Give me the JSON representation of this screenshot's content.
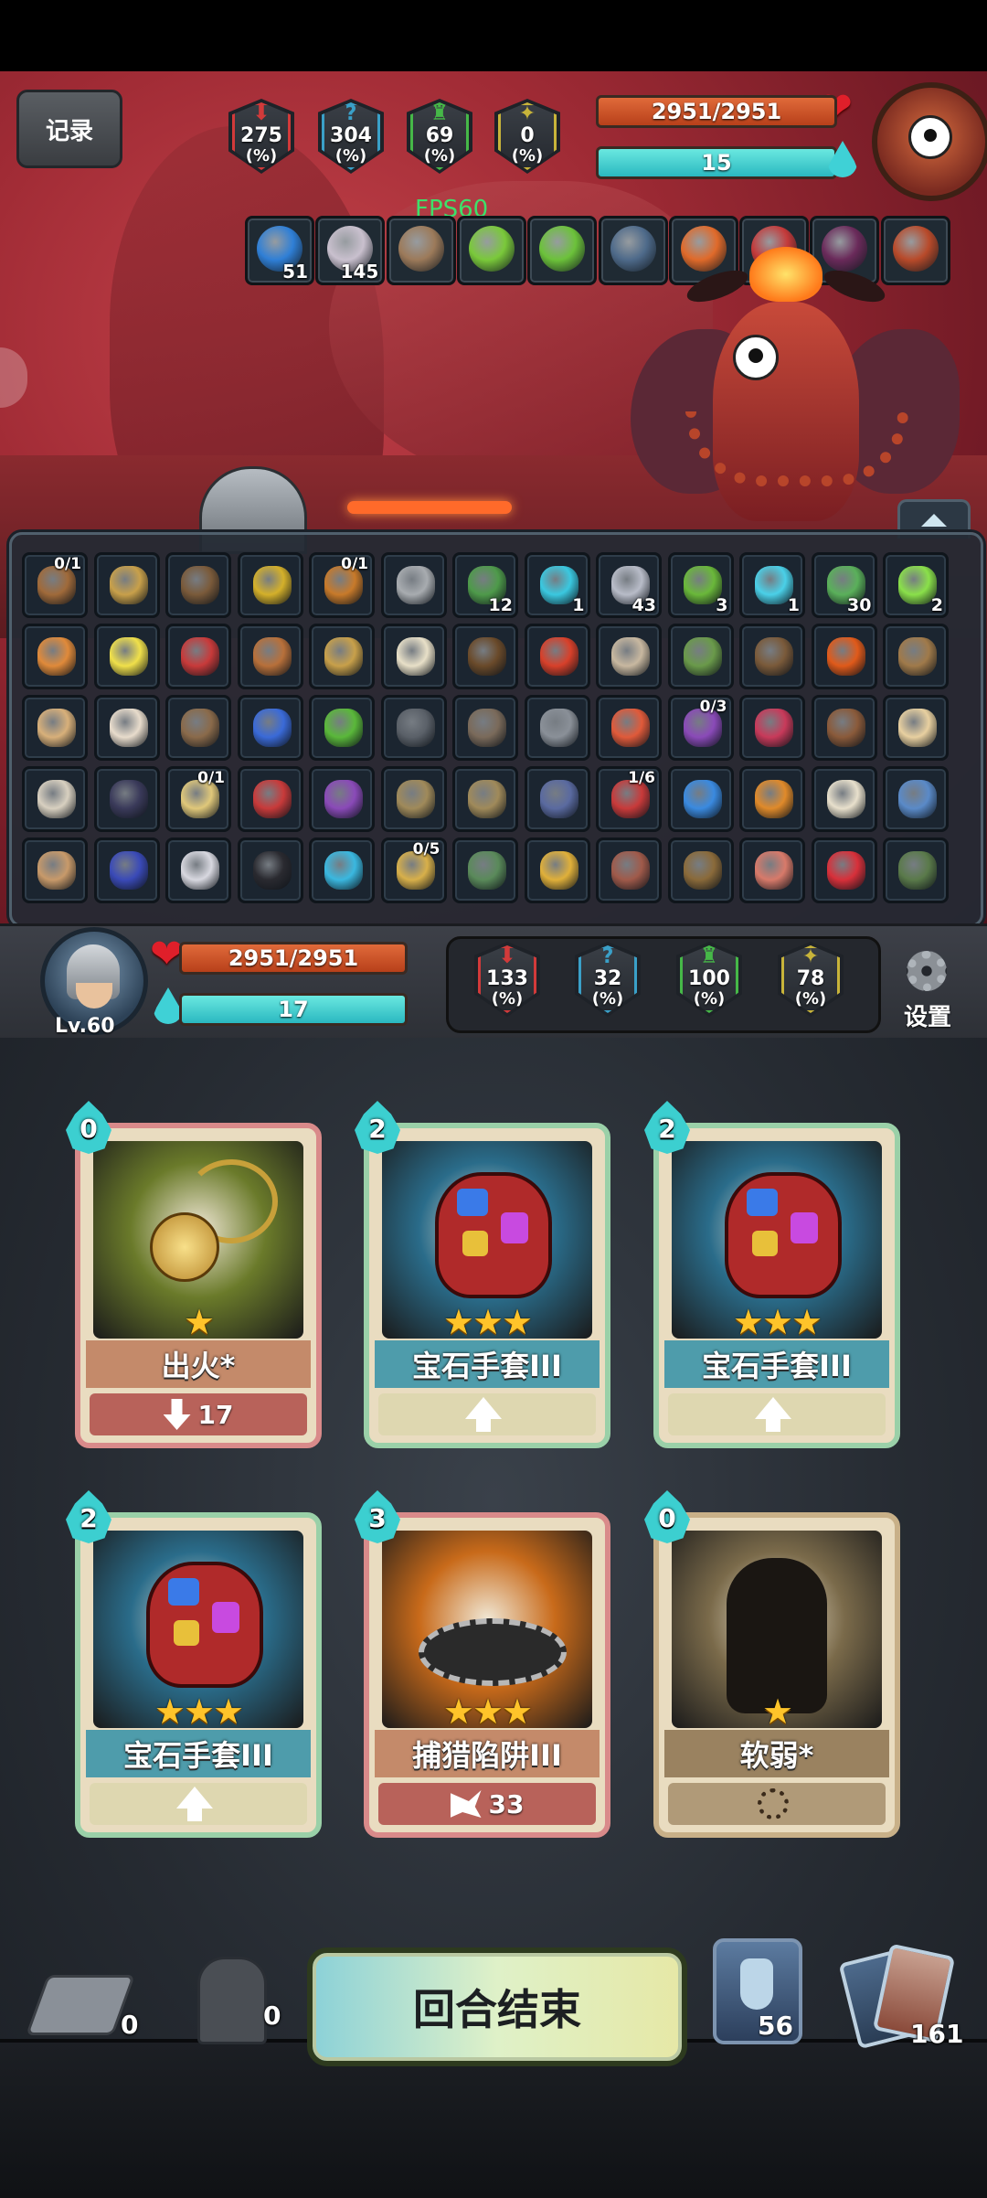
{
  "top": {
    "log_button": "记录",
    "fps": "FPS60",
    "stats": [
      {
        "value": "275",
        "unit": "(%)",
        "icon": "attack-sword-icon",
        "color": "#d23a3a"
      },
      {
        "value": "304",
        "unit": "(%)",
        "icon": "question-mark-icon",
        "color": "#3aa0c8"
      },
      {
        "value": "69",
        "unit": "(%)",
        "icon": "defense-tower-icon",
        "color": "#46b848"
      },
      {
        "value": "0",
        "unit": "(%)",
        "icon": "spike-icon",
        "color": "#c8b43a"
      }
    ],
    "enemy_hp": "2951/2951",
    "enemy_hp_fraction": 1.0,
    "enemy_energy": "15",
    "enemy_energy_fraction": 1.0,
    "buffs": [
      {
        "icon": "blue-shield-icon",
        "count": "51",
        "color": "#2f7fd6"
      },
      {
        "icon": "swirl-orb-icon",
        "count": "145",
        "color": "#c9c0ce"
      },
      {
        "icon": "spellbook-icon",
        "count": "",
        "color": "#9c7a5a"
      },
      {
        "icon": "green-slime-icon",
        "count": "",
        "color": "#7ac93a"
      },
      {
        "icon": "green-gem-icon",
        "count": "",
        "color": "#6cc23a"
      },
      {
        "icon": "dark-tower-icon",
        "count": "",
        "color": "#4e6a8a"
      },
      {
        "icon": "fire-claw-icon",
        "count": "",
        "color": "#e06a2a"
      },
      {
        "icon": "red-crab-icon",
        "count": "",
        "color": "#c43a3a"
      },
      {
        "icon": "purple-claw-icon",
        "count": "",
        "color": "#6a2a5a"
      },
      {
        "icon": "bead-necklace-icon",
        "count": "",
        "color": "#b84a2a"
      }
    ]
  },
  "inventory": {
    "items": [
      {
        "icon": "sack-icon",
        "color": "#a06a3a",
        "frac": "0/1",
        "count": ""
      },
      {
        "icon": "hourglass-icon",
        "color": "#c8a04a",
        "frac": "",
        "count": ""
      },
      {
        "icon": "scroll-icon",
        "color": "#7a5a3a",
        "frac": "",
        "count": ""
      },
      {
        "icon": "golden-swirl-icon",
        "color": "#d4b02a",
        "frac": "",
        "count": ""
      },
      {
        "icon": "horn-icon",
        "color": "#c87a2a",
        "frac": "0/1",
        "count": ""
      },
      {
        "icon": "helmet-icon",
        "color": "#a8acb0",
        "frac": "",
        "count": ""
      },
      {
        "icon": "green-serpent-icon",
        "color": "#4e9a4a",
        "frac": "",
        "count": "12"
      },
      {
        "icon": "cyan-crescent-icon",
        "color": "#3ac8e0",
        "frac": "",
        "count": "1"
      },
      {
        "icon": "silver-helm-icon",
        "color": "#b8bcc8",
        "frac": "",
        "count": "43"
      },
      {
        "icon": "green-blob-icon",
        "color": "#6ab83a",
        "frac": "",
        "count": "3"
      },
      {
        "icon": "cyan-face-icon",
        "color": "#4ad0e8",
        "frac": "",
        "count": "1"
      },
      {
        "icon": "green-skull-icon",
        "color": "#5ab05a",
        "frac": "",
        "count": "30"
      },
      {
        "icon": "green-slash-icon",
        "color": "#8ae04a",
        "frac": "",
        "count": "2"
      },
      {
        "icon": "wrench-icon",
        "color": "#e08a3a",
        "frac": "",
        "count": ""
      },
      {
        "icon": "sun-burst-icon",
        "color": "#f0e04a",
        "frac": "",
        "count": ""
      },
      {
        "icon": "red-glove-icon",
        "color": "#c83a3a",
        "frac": "",
        "count": ""
      },
      {
        "icon": "cookie-icon",
        "color": "#b8703a",
        "frac": "",
        "count": ""
      },
      {
        "icon": "hourglass-icon",
        "color": "#c8a04a",
        "frac": "",
        "count": ""
      },
      {
        "icon": "dice-icon",
        "color": "#e8e0c8",
        "frac": "",
        "count": ""
      },
      {
        "icon": "coin-pouch-icon",
        "color": "#6a4a2a",
        "frac": "",
        "count": ""
      },
      {
        "icon": "red-feather-icon",
        "color": "#d8402a",
        "frac": "",
        "count": ""
      },
      {
        "icon": "bell-icon",
        "color": "#c8b8a0",
        "frac": "",
        "count": ""
      },
      {
        "icon": "green-flask-icon",
        "color": "#6a9a4a",
        "frac": "",
        "count": ""
      },
      {
        "icon": "voodoo-doll-icon",
        "color": "#7a5a3a",
        "frac": "",
        "count": ""
      },
      {
        "icon": "fire-apple-icon",
        "color": "#e05a1a",
        "frac": "",
        "count": ""
      },
      {
        "icon": "broom-icon",
        "color": "#a07a4a",
        "frac": "",
        "count": ""
      },
      {
        "icon": "parchment-icon",
        "color": "#d8b07a",
        "frac": "",
        "count": ""
      },
      {
        "icon": "bone-icon",
        "color": "#e8dccc",
        "frac": "",
        "count": ""
      },
      {
        "icon": "wooden-stakes-icon",
        "color": "#8a6a4a",
        "frac": "",
        "count": ""
      },
      {
        "icon": "blue-dagger-icon",
        "color": "#3a6ad8",
        "frac": "",
        "count": ""
      },
      {
        "icon": "green-coin-icon",
        "color": "#5ab83a",
        "frac": "",
        "count": ""
      },
      {
        "icon": "dark-cloak-icon",
        "color": "#5a6068",
        "frac": "",
        "count": ""
      },
      {
        "icon": "crossbow-icon",
        "color": "#7a6a5a",
        "frac": "",
        "count": ""
      },
      {
        "icon": "trident-icon",
        "color": "#8a9098",
        "frac": "",
        "count": ""
      },
      {
        "icon": "fire-spear-icon",
        "color": "#e05a3a",
        "frac": "",
        "count": ""
      },
      {
        "icon": "purple-worm-icon",
        "color": "#8a4ab8",
        "frac": "0/3",
        "count": ""
      },
      {
        "icon": "red-wand-icon",
        "color": "#c83a5a",
        "frac": "",
        "count": ""
      },
      {
        "icon": "leather-glove-icon",
        "color": "#8a5a3a",
        "frac": "",
        "count": ""
      },
      {
        "icon": "potion-bag-icon",
        "color": "#e8d0a0",
        "frac": "",
        "count": ""
      },
      {
        "icon": "claw-icon",
        "color": "#d8d0c0",
        "frac": "",
        "count": ""
      },
      {
        "icon": "spiked-ball-icon",
        "color": "#3a3a5a",
        "frac": "",
        "count": ""
      },
      {
        "icon": "pacifier-icon",
        "color": "#e0c87a",
        "frac": "0/1",
        "count": ""
      },
      {
        "icon": "red-orb-icon",
        "color": "#c83a3a",
        "frac": "",
        "count": ""
      },
      {
        "icon": "mask-icon",
        "color": "#8a4ab8",
        "frac": "",
        "count": ""
      },
      {
        "icon": "scales-icon",
        "color": "#a08a5a",
        "frac": "",
        "count": ""
      },
      {
        "icon": "scales-icon",
        "color": "#a08a5a",
        "frac": "",
        "count": ""
      },
      {
        "icon": "gauntlet-icon",
        "color": "#5a6aa0",
        "frac": "",
        "count": ""
      },
      {
        "icon": "red-tome-icon",
        "color": "#c83a3a",
        "frac": "1/6",
        "count": ""
      },
      {
        "icon": "blue-swirl-icon",
        "color": "#3a8ae0",
        "frac": "",
        "count": ""
      },
      {
        "icon": "fire-staff-icon",
        "color": "#e08a2a",
        "frac": "",
        "count": ""
      },
      {
        "icon": "bandage-icon",
        "color": "#e8e0cc",
        "frac": "",
        "count": ""
      },
      {
        "icon": "blue-key-icon",
        "color": "#5a8ac8",
        "frac": "",
        "count": ""
      },
      {
        "icon": "hooded-head-icon",
        "color": "#c89a6a",
        "frac": "",
        "count": ""
      },
      {
        "icon": "blue-crest-icon",
        "color": "#3a4ab8",
        "frac": "",
        "count": ""
      },
      {
        "icon": "ghost-boot-icon",
        "color": "#d8d8e0",
        "frac": "",
        "count": ""
      },
      {
        "icon": "black-mask-icon",
        "color": "#2a2a30",
        "frac": "",
        "count": ""
      },
      {
        "icon": "cyan-rune-icon",
        "color": "#3ab8e0",
        "frac": "",
        "count": ""
      },
      {
        "icon": "golden-ring-icon",
        "color": "#d8b04a",
        "frac": "0/5",
        "count": ""
      },
      {
        "icon": "green-helm-icon",
        "color": "#5a8a5a",
        "frac": "",
        "count": ""
      },
      {
        "icon": "gold-amulet-icon",
        "color": "#e0b03a",
        "frac": "",
        "count": ""
      },
      {
        "icon": "thorn-branch-icon",
        "color": "#a05a4a",
        "frac": "",
        "count": ""
      },
      {
        "icon": "mushroom-icon",
        "color": "#8a6a3a",
        "frac": "",
        "count": ""
      },
      {
        "icon": "meat-icon",
        "color": "#d87a6a",
        "frac": "",
        "count": ""
      },
      {
        "icon": "rose-icon",
        "color": "#d8303a",
        "frac": "",
        "count": ""
      },
      {
        "icon": "dragon-egg-icon",
        "color": "#5a7a4a",
        "frac": "",
        "count": ""
      }
    ]
  },
  "player": {
    "level": "Lv.60",
    "hp": "2951/2951",
    "hp_fraction": 1.0,
    "energy": "17",
    "energy_fraction": 1.0,
    "stats": [
      {
        "value": "133",
        "unit": "(%)",
        "icon": "attack-sword-icon",
        "color": "#d23a3a"
      },
      {
        "value": "32",
        "unit": "(%)",
        "icon": "question-mark-icon",
        "color": "#3aa0c8"
      },
      {
        "value": "100",
        "unit": "(%)",
        "icon": "defense-tower-icon",
        "color": "#46b848"
      },
      {
        "value": "78",
        "unit": "(%)",
        "icon": "spike-icon",
        "color": "#c8b43a"
      }
    ],
    "settings_label": "设置"
  },
  "cards": [
    {
      "cost": "0",
      "name": "出火*",
      "stars": 1,
      "foot_value": "17",
      "foot_icon": "arrow-down-icon",
      "art": "golden-bell-art",
      "border": "#d98a8a",
      "title_bg": "#c48a6a",
      "foot_bg": "#b8625a",
      "art_bg": "#6a7a2a"
    },
    {
      "cost": "2",
      "name": "宝石手套III",
      "stars": 3,
      "foot_value": "",
      "foot_icon": "arrow-up-icon",
      "art": "gem-gauntlet-art",
      "border": "#9ad0a8",
      "title_bg": "#4e9cab",
      "foot_bg": "#ded7b0",
      "art_bg": "#2a6c8a"
    },
    {
      "cost": "2",
      "name": "宝石手套III",
      "stars": 3,
      "foot_value": "",
      "foot_icon": "arrow-up-icon",
      "art": "gem-gauntlet-art",
      "border": "#9ad0a8",
      "title_bg": "#4e9cab",
      "foot_bg": "#ded7b0",
      "art_bg": "#2a6c8a"
    },
    {
      "cost": "2",
      "name": "宝石手套III",
      "stars": 3,
      "foot_value": "",
      "foot_icon": "arrow-up-icon",
      "art": "gem-gauntlet-art",
      "border": "#9ad0a8",
      "title_bg": "#4e9cab",
      "foot_bg": "#ded7b0",
      "art_bg": "#2a6c8a"
    },
    {
      "cost": "3",
      "name": "捕猎陷阱III",
      "stars": 3,
      "foot_value": "33",
      "foot_icon": "claw-icon",
      "art": "bear-trap-art",
      "border": "#d98a8a",
      "title_bg": "#c48a6a",
      "foot_bg": "#b8625a",
      "art_bg": "#c86a1a"
    },
    {
      "cost": "0",
      "name": "软弱*",
      "stars": 1,
      "foot_value": "",
      "foot_icon": "spiral-icon",
      "art": "weak-silhouette-art",
      "border": "#c8b088",
      "title_bg": "#9a8260",
      "foot_bg": "#b09a78",
      "art_bg": "#7a6a4a"
    }
  ],
  "bottom": {
    "end_turn": "回合结束",
    "discard_count": "0",
    "exhaust_count": "0",
    "potion_count": "56",
    "deck_count": "161"
  }
}
